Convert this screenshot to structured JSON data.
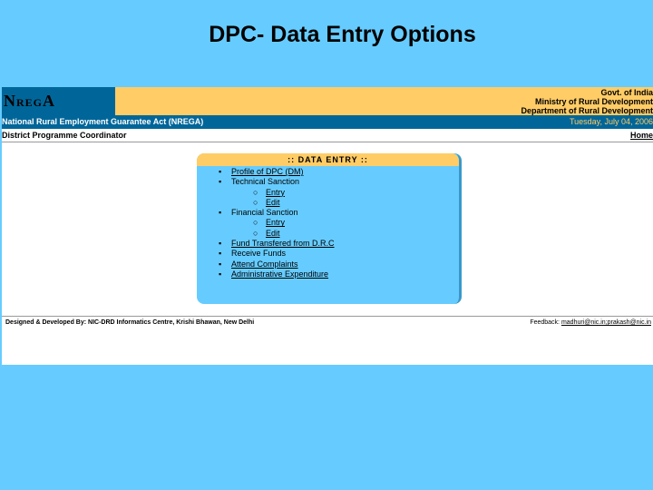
{
  "slide_title": "DPC- Data Entry Options",
  "header": {
    "logo": {
      "n": "N",
      "reg": "REG",
      "a": "A"
    },
    "govt_lines": [
      "Govt. of India",
      "Ministry of Rural Development",
      "Department of Rural Development"
    ],
    "act_title": "National Rural Employment Guarantee Act (NREGA)",
    "date": "Tuesday, July 04, 2006",
    "role": "District Programme Coordinator",
    "home": "Home"
  },
  "panel": {
    "heading": ":: DATA ENTRY ::",
    "items": [
      {
        "label": "Profile of DPC (DM)",
        "level": 1,
        "link": true
      },
      {
        "label": "Technical Sanction",
        "level": 1,
        "link": false
      },
      {
        "label": "Entry",
        "level": 2,
        "link": true
      },
      {
        "label": "Edit",
        "level": 2,
        "link": true
      },
      {
        "label": "Financial Sanction",
        "level": 1,
        "link": false
      },
      {
        "label": "Entry",
        "level": 2,
        "link": true
      },
      {
        "label": "Edit",
        "level": 2,
        "link": true
      },
      {
        "label": "Fund Transfered from D.R.C",
        "level": 1,
        "link": true
      },
      {
        "label": "Receive Funds",
        "level": 1,
        "link": false
      },
      {
        "label": "Attend Complaints",
        "level": 1,
        "link": true
      },
      {
        "label": "Administrative Expenditure",
        "level": 1,
        "link": true
      }
    ]
  },
  "footer": {
    "credit": "Designed & Developed By: NIC-DRD Informatics Centre, Krishi Bhawan, New Delhi",
    "feedback_label": "Feedback:",
    "feedback_email": "madhuri@nic.in;prakash@nic.in"
  },
  "colors": {
    "background": "#66ccff",
    "banner": "#ffcc66",
    "bar": "#006699"
  }
}
